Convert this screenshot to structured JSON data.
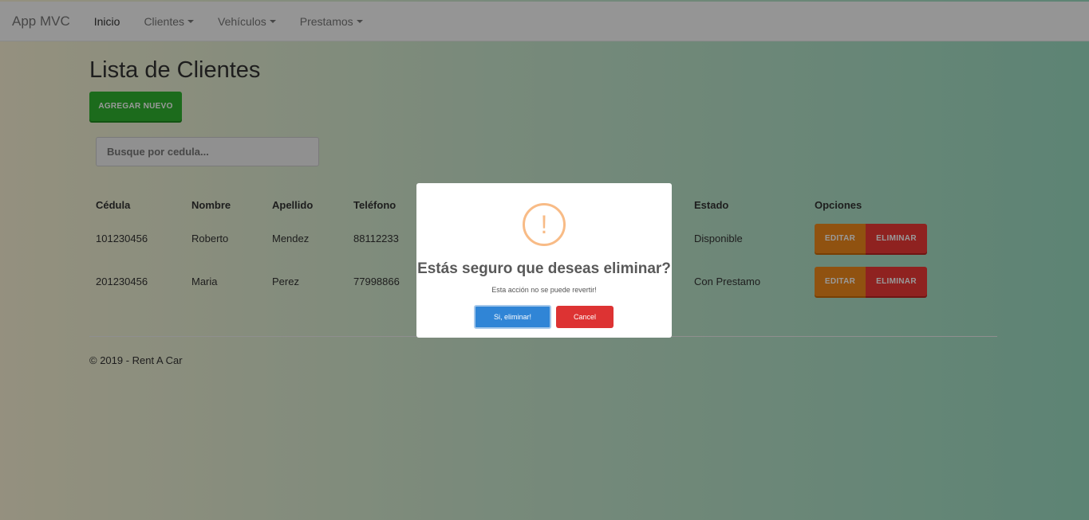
{
  "navbar": {
    "brand": "App MVC",
    "items": [
      {
        "label": "Inicio"
      },
      {
        "label": "Clientes"
      },
      {
        "label": "Vehículos"
      },
      {
        "label": "Prestamos"
      }
    ]
  },
  "page": {
    "title": "Lista de Clientes",
    "add_button": "AGREGAR NUEVO",
    "search_placeholder": "Busque por cedula..."
  },
  "table": {
    "headers": [
      "Cédula",
      "Nombre",
      "Apellido",
      "Teléfono",
      "Estado",
      "Opciones"
    ],
    "rows": [
      {
        "cedula": "101230456",
        "nombre": "Roberto",
        "apellido": "Mendez",
        "telefono": "88112233",
        "estado": "Disponible"
      },
      {
        "cedula": "201230456",
        "nombre": "Maria",
        "apellido": "Perez",
        "telefono": "77998866",
        "estado": "Con Prestamo"
      }
    ],
    "edit_label": "EDITAR",
    "delete_label": "ELIMINAR"
  },
  "footer": {
    "text": "© 2019 - Rent A Car"
  },
  "modal": {
    "icon_symbol": "!",
    "title": "Estás seguro que deseas eliminar?",
    "text": "Esta acción no se puede revertir!",
    "confirm_label": "Si, eliminar!",
    "cancel_label": "Cancel"
  },
  "colors": {
    "add_button": "#2fb22f",
    "edit_button": "#f0891c",
    "delete_button": "#ee3a36",
    "confirm_button": "#3085d6",
    "cancel_button": "#dd3333",
    "warning_icon": "#f8bb86"
  }
}
